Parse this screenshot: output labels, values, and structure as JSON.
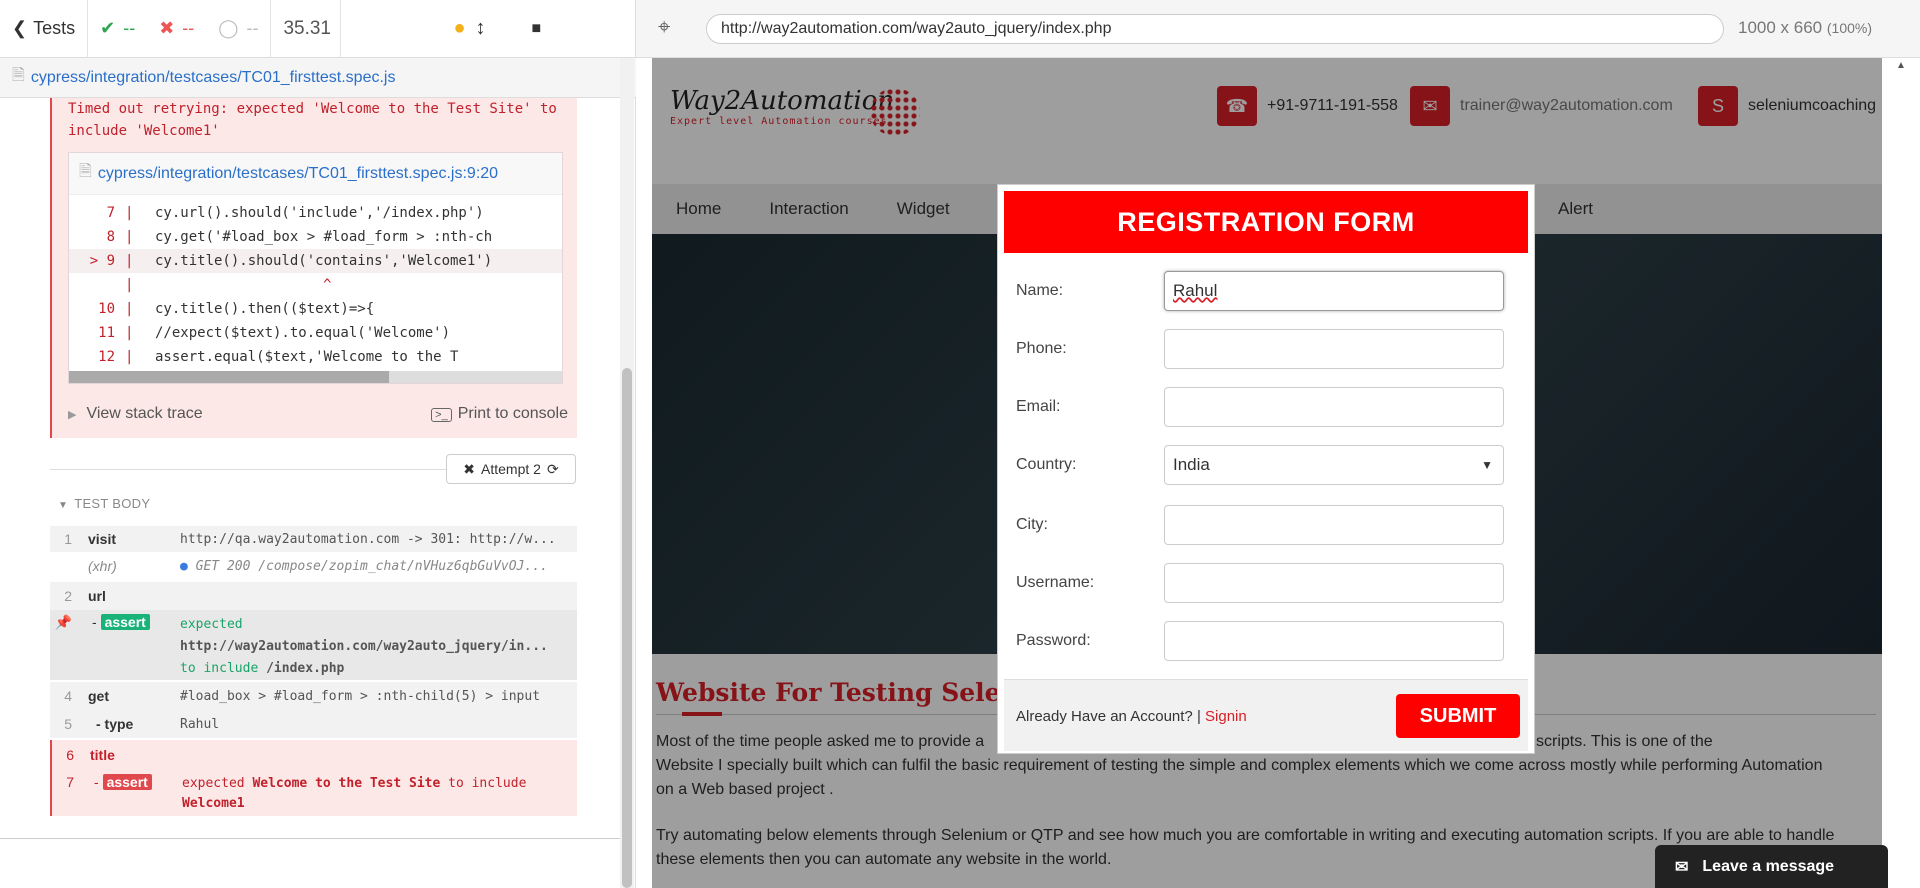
{
  "reporter": {
    "back_label": "Tests",
    "passed": "--",
    "failed": "--",
    "pending": "--",
    "duration": "35.31",
    "spec_file": "cypress/integration/testcases/TC01_firsttest.spec.js",
    "error_message": "Timed out retrying: expected 'Welcome to the Test Site' to include 'Welcome1'",
    "code_file": "cypress/integration/testcases/TC01_firsttest.spec.js:9:20",
    "code_lines": [
      {
        "num": "7",
        "text": "cy.url().should('include','/index.php')"
      },
      {
        "num": "8",
        "text": "cy.get('#load_box > #load_form > :nth-ch"
      },
      {
        "num": "9",
        "text": "cy.title().should('contains','Welcome1')"
      },
      {
        "num": "",
        "text": "^"
      },
      {
        "num": "10",
        "text": "cy.title().then(($text)=>{"
      },
      {
        "num": "11",
        "text": "    //expect($text).to.equal('Welcome')"
      },
      {
        "num": "12",
        "text": "    assert.equal($text,'Welcome to the T"
      }
    ],
    "view_stack": "View stack trace",
    "print_console": "Print to console",
    "attempt": "Attempt 2",
    "test_body": "TEST BODY",
    "commands": [
      {
        "num": "1",
        "name": "visit",
        "msg": "http://qa.way2automation.com -> 301: http://w..."
      },
      {
        "num": "",
        "name": "(xhr)",
        "msg": "GET 200 /compose/zopim_chat/nVHuz6qbGuVvOJ..."
      },
      {
        "num": "2",
        "name": "url",
        "msg": ""
      },
      {
        "num": "",
        "name": "- assert",
        "msg": "expected http://way2automation.com/way2auto_jquery/in... to include /index.php"
      },
      {
        "num": "4",
        "name": "get",
        "msg": "#load_box > #load_form > :nth-child(5) > input"
      },
      {
        "num": "5",
        "name": "- type",
        "msg": "Rahul"
      },
      {
        "num": "6",
        "name": "title",
        "msg": ""
      },
      {
        "num": "7",
        "name": "- assert",
        "msg": "expected Welcome to the Test Site to include Welcome1"
      }
    ],
    "assert_url_expected": "expected",
    "assert_url_value": "http://way2automation.com/way2auto_jquery/in...",
    "assert_url_to_include": "to include",
    "assert_url_include": "/index.php",
    "assert_title_expected": "expected",
    "assert_title_value": "Welcome to the Test Site",
    "assert_title_to_include": "to include",
    "assert_title_include": "Welcome1"
  },
  "browser": {
    "url": "http://way2automation.com/way2auto_jquery/index.php",
    "viewport": "1000 x 660",
    "zoom": "(100%)"
  },
  "site": {
    "logo": "Way2Automation",
    "tagline": "Expert level Automation courses",
    "phone": "+91-9711-191-558",
    "email": "trainer@way2automation.com",
    "skype": "seleniumcoaching",
    "nav": [
      "Home",
      "Interaction",
      "Widget",
      "Alert"
    ],
    "heading": "Website For Testing Seleniu",
    "para1_a": "Most of the time people asked me to provide a",
    "para1_b": "heir Selenium or QTP scripts. This is one of the",
    "para1_c": "Website I specially built which can fulfil the basic requirement of testing the simple and complex elements which we come across mostly while performing Automation",
    "para1_d": "on a Web based project .",
    "para2_a": "Try automating below elements through Selenium or QTP and see how much you are comfortable in writing and executing automation scripts. If you are able to handle",
    "para2_b": "these elements then you can automate any website in the world.",
    "leave_message": "Leave a message"
  },
  "modal": {
    "title": "REGISTRATION FORM",
    "fields": [
      {
        "label": "Name:",
        "value": "Rahul"
      },
      {
        "label": "Phone:",
        "value": ""
      },
      {
        "label": "Email:",
        "value": ""
      },
      {
        "label": "Country:",
        "value": "India"
      },
      {
        "label": "City:",
        "value": ""
      },
      {
        "label": "Username:",
        "value": ""
      },
      {
        "label": "Password:",
        "value": ""
      }
    ],
    "already": "Already Have an Account? |",
    "signin": "Signin",
    "submit": "SUBMIT"
  }
}
